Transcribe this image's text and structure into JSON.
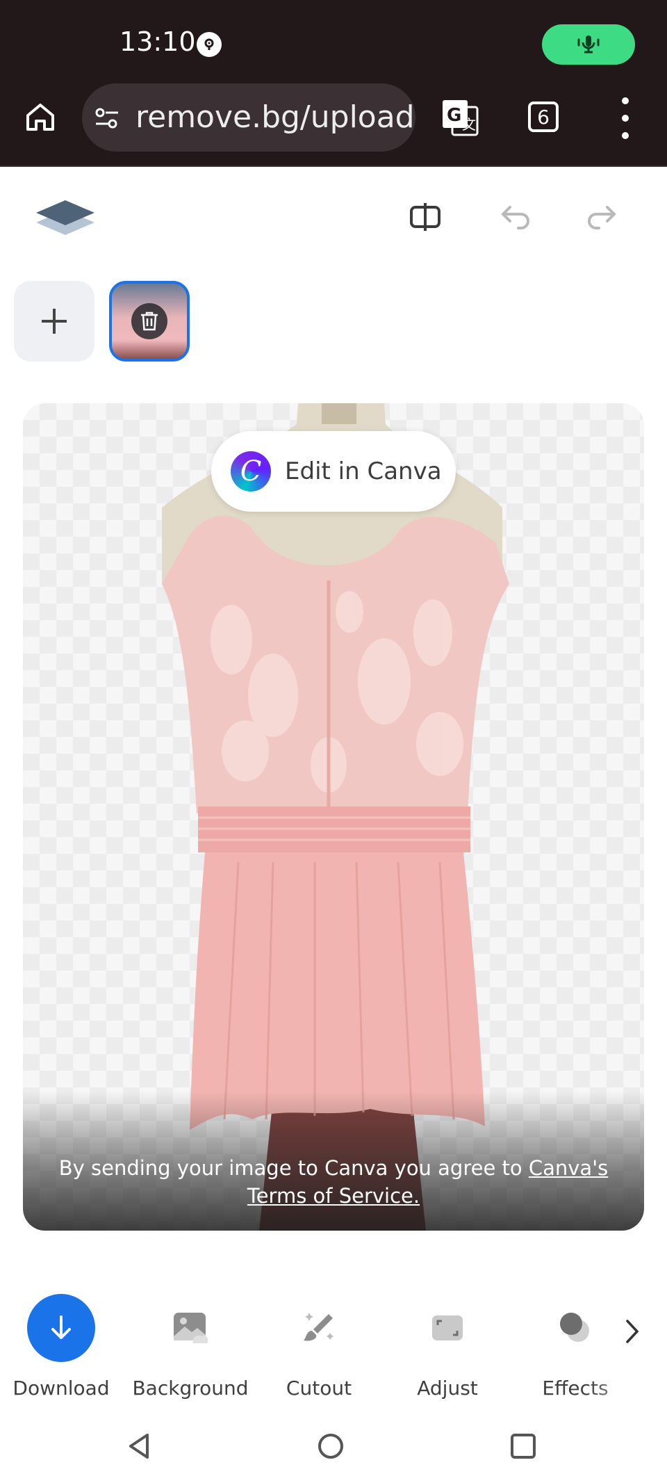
{
  "status_bar": {
    "time": "13:10"
  },
  "browser": {
    "url": "remove.bg/upload",
    "tab_count": "6"
  },
  "canvas": {
    "edit_button_label": "Edit in Canva",
    "canva_logo_letter": "C",
    "terms_prefix": "By sending your image to Canva you agree to ",
    "terms_link": "Canva's Terms of Service."
  },
  "tools": [
    {
      "label": "Download",
      "icon": "download-icon"
    },
    {
      "label": "Background",
      "icon": "image-icon"
    },
    {
      "label": "Cutout",
      "icon": "brush-icon"
    },
    {
      "label": "Adjust",
      "icon": "adjust-icon"
    },
    {
      "label": "Effects",
      "icon": "effects-icon"
    }
  ],
  "colors": {
    "accent": "#1a73e8",
    "chrome_bg": "#22181a",
    "mic_pill": "#3ddc84"
  }
}
